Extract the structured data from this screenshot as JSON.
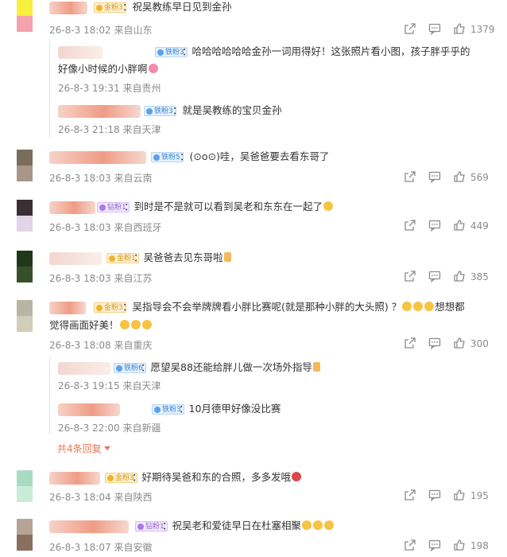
{
  "comments": [
    {
      "badge": "金粉3",
      "text": "：祝吴教练早日见到金孙",
      "time": "26-8-3 18:02",
      "place": "来自山东",
      "likes": "1379",
      "replies": [
        {
          "badge": "铁粉3",
          "text1": "：哈哈哈哈哈哈金孙一词用得好！这张照片看小图，孩子胖乎乎的",
          "text2": "好像小时候的小胖啊",
          "time": "26-8-3 19:31",
          "place": "来自贵州"
        },
        {
          "badge": "铁粉3",
          "text": "：就是吴教练的宝贝金孙",
          "time": "26-8-3 21:18",
          "place": "来自天津"
        }
      ]
    },
    {
      "badge": "铁粉5",
      "text": "：(⊙o⊙)哇，吴爸爸要去看东哥了",
      "time": "26-8-3 18:03",
      "place": "来自云南",
      "likes": "569"
    },
    {
      "badge": "钻粉1",
      "text": "：到时是不是就可以看到吴老和东东在一起了",
      "time": "26-8-3 18:03",
      "place": "来自西班牙",
      "likes": "449"
    },
    {
      "badge": "金粉1",
      "text": "：吴爸爸去见东哥啦",
      "time": "26-8-3 18:03",
      "place": "来自江苏",
      "likes": "385"
    },
    {
      "badge": "金粉3",
      "text1": "：吴指导会不会举牌牌看小胖比赛呢(就是那种小胖的大头照) ？",
      "text1b": "想想都",
      "text2": "觉得画面好美！",
      "time": "26-8-3 18:08",
      "place": "来自重庆",
      "likes": "300",
      "replies": [
        {
          "badge": "铁粉6",
          "text": "：愿望吴88还能给胖儿做一次场外指导",
          "time": "26-8-3 19:15",
          "place": "来自天津"
        },
        {
          "badge": "铁粉3",
          "text": "：10月德甲好像没比赛",
          "time": "26-8-3 22:00",
          "place": "来自新疆"
        }
      ],
      "more": "共4条回复"
    },
    {
      "badge": "金粉3",
      "text": "：好期待吴爸和东的合照，多多发哦",
      "time": "26-8-3 18:04",
      "place": "来自陕西",
      "likes": "195"
    },
    {
      "badge": "钻粉1",
      "text": "：祝吴老和爱徒早日在杜塞相聚",
      "time": "26-8-3 18:07",
      "place": "来自安徽",
      "likes": "198"
    }
  ],
  "colors": {
    "accent": "#eb7350",
    "meta": "#8b8b8b"
  },
  "icons": {
    "share": "share-icon",
    "comment": "comment-icon",
    "like": "like-icon",
    "more": "chevron-down-icon"
  }
}
